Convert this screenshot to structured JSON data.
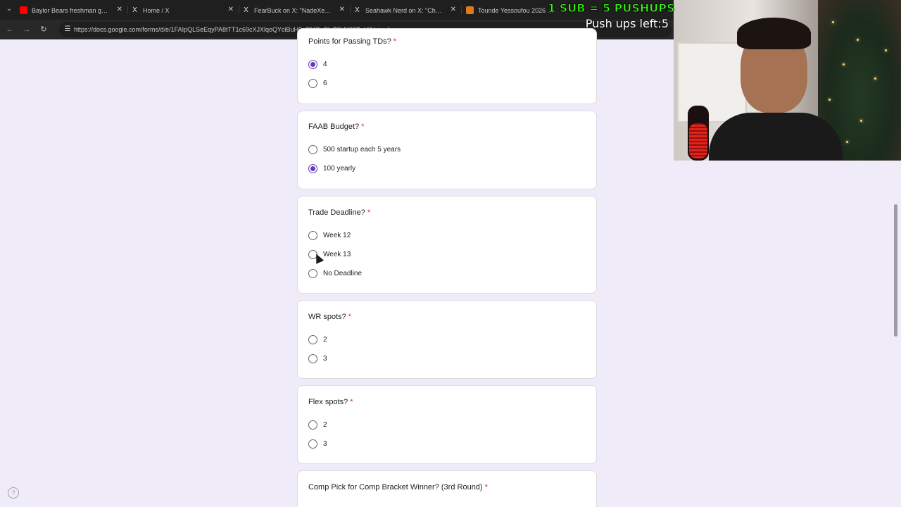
{
  "browser": {
    "tabs": [
      {
        "label": "Baylor Bears freshman guard To",
        "icon": "youtube-icon"
      },
      {
        "label": "Home / X",
        "icon": "x-icon"
      },
      {
        "label": "FearBuck on X: \"NadeXe crashe",
        "icon": "x-icon"
      },
      {
        "label": "Seahawk Nerd on X: \"Champi",
        "icon": "x-icon"
      },
      {
        "label": "Tounde Yessoufou 2026 Draft",
        "icon": "tankathon-icon"
      }
    ],
    "url": "https://docs.google.com/forms/d/e/1FAIpQLSeEqyPA8tTT1c69cXJXlqoQYciBuH9yOMO_Bly7SbM68BokfA/viewform"
  },
  "overlay": {
    "sub_text": "1 SUB = 5 PUSHUPS",
    "pushups_left": "Push ups left:5"
  },
  "form": {
    "questions": [
      {
        "title": "Points for Passing TDs?",
        "required": "*",
        "options": [
          "4",
          "6"
        ],
        "selected": "4"
      },
      {
        "title": "FAAB Budget?",
        "required": "*",
        "options": [
          "500 startup each 5 years",
          "100 yearly"
        ],
        "selected": "100 yearly"
      },
      {
        "title": "Trade Deadline?",
        "required": "*",
        "options": [
          "Week 12",
          "Week 13",
          "No Deadline"
        ],
        "selected": ""
      },
      {
        "title": "WR spots?",
        "required": "*",
        "options": [
          "2",
          "3"
        ],
        "selected": ""
      },
      {
        "title": "Flex spots?",
        "required": "*",
        "options": [
          "2",
          "3"
        ],
        "selected": ""
      },
      {
        "title": "Comp Pick for Comp Bracket Winner? (3rd Round)",
        "required": "*",
        "options": [],
        "selected": ""
      }
    ]
  },
  "colors": {
    "accent": "#673ab7",
    "background": "#f0ebf8",
    "required": "#d93025"
  }
}
